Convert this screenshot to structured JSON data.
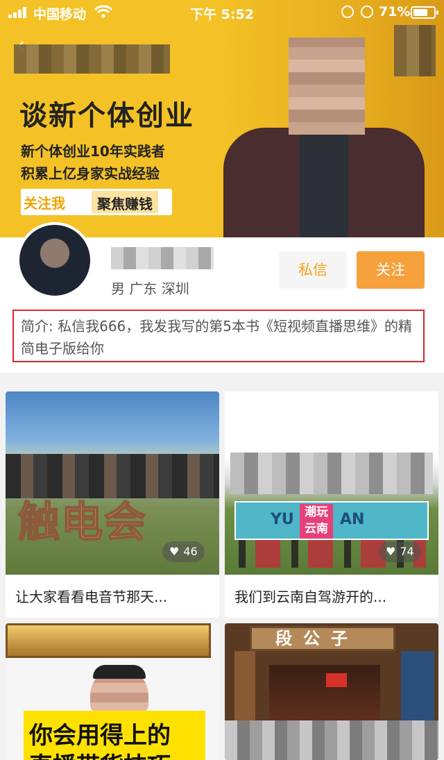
{
  "status_bar": {
    "carrier": "中国移动",
    "time": "下午 5:52",
    "battery": "71%",
    "battery_level": 0.71
  },
  "banner": {
    "headline": "谈新个体创业",
    "line1": "新个体创业10年实践者",
    "line2": "积累上亿身家实战经验",
    "tag_follow": "关注我",
    "tag_focus": "聚焦赚钱",
    "accent_color": "#f4c227"
  },
  "profile": {
    "location": "男  广东 深圳",
    "message_label": "私信",
    "follow_label": "关注",
    "bio": "简介: 私信我666，我发我写的第5本书《短视频直播思维》的精简电子版给你",
    "follow_color": "#f6a13c",
    "highlight_border_color": "#d8262c"
  },
  "posts": [
    {
      "caption": "让大家看看电音节那天...",
      "likes": "46",
      "overlay": "触电会"
    },
    {
      "caption": "我们到云南自驾游开的...",
      "likes": "74",
      "overlay_left": "YU",
      "overlay_badge": "潮玩云南",
      "overlay_right": "AN"
    },
    {
      "overlay_line1": "你会用得上的",
      "overlay_line2": "直播带货技巧"
    },
    {
      "sign": "段公子"
    }
  ]
}
